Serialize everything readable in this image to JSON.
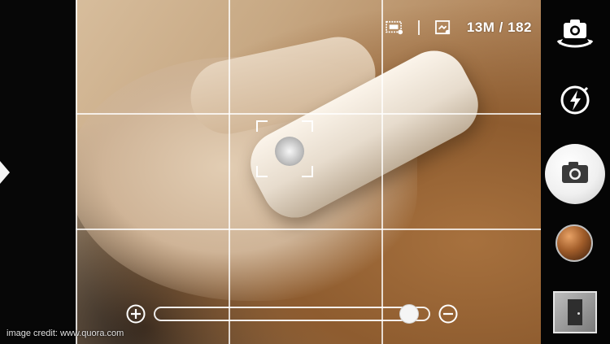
{
  "status_bar": {
    "storage_count": "13M / 182",
    "icons": [
      "scene-mode-icon",
      "storage-icon"
    ]
  },
  "controls": {
    "switch_camera": "switch-camera-icon",
    "flash": "flash-auto-icon",
    "shutter": "camera-shutter-icon",
    "effects": "effects-icon",
    "gallery": "gallery-thumbnail"
  },
  "zoom": {
    "plus_icon": "zoom-in-icon",
    "minus_icon": "zoom-out-icon",
    "level": 0.96
  },
  "credit": "image credit: www.quora.com",
  "colors": {
    "grid": "#ffffff",
    "panel": "#050505"
  }
}
